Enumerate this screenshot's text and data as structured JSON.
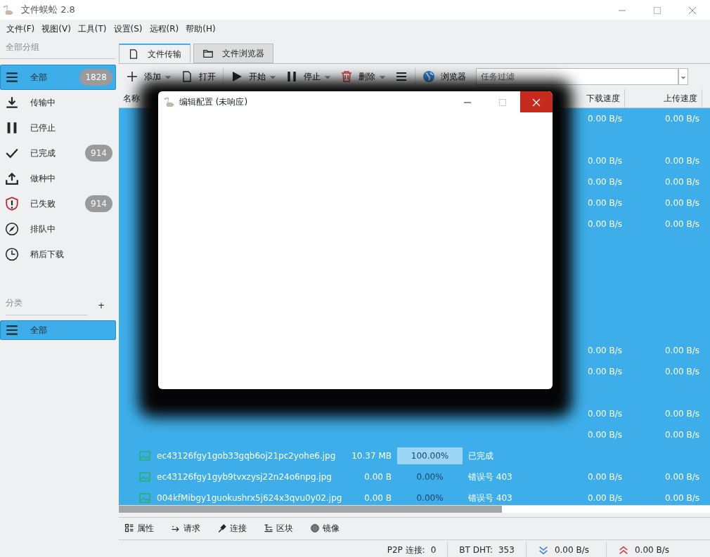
{
  "window": {
    "title": "文件蜈蚣 2.8"
  },
  "menu": [
    "文件(F)",
    "视图(V)",
    "工具(T)",
    "设置(S)",
    "远程(R)",
    "帮助(H)"
  ],
  "sidebar": {
    "groups_label": "全部分组",
    "items": [
      {
        "label": "全部",
        "kind": "menu",
        "count": "1828",
        "selected": true
      },
      {
        "label": "传输中",
        "kind": "download",
        "selected": false
      },
      {
        "label": "已停止",
        "kind": "pause",
        "selected": false
      },
      {
        "label": "已完成",
        "kind": "check",
        "count": "914",
        "selected": false
      },
      {
        "label": "做种中",
        "kind": "upload",
        "selected": false
      },
      {
        "label": "已失败",
        "kind": "shield",
        "count": "914",
        "selected": false
      },
      {
        "label": "排队中",
        "kind": "compass",
        "selected": false
      },
      {
        "label": "稍后下载",
        "kind": "clock",
        "selected": false
      }
    ],
    "categories_label": "分类",
    "add_label": "+",
    "categories": [
      {
        "label": "全部",
        "selected": true
      }
    ]
  },
  "tabs": [
    {
      "label": "文件传输",
      "kind": "file",
      "selected": true
    },
    {
      "label": "文件浏览器",
      "kind": "folder",
      "selected": false
    }
  ],
  "toolbar": [
    {
      "label": "添加",
      "kind": "plus",
      "dropdown": true
    },
    {
      "label": "打开",
      "kind": "file",
      "dropdown": false
    },
    {
      "label": "开始",
      "kind": "play",
      "dropdown": true
    },
    {
      "label": "停止",
      "kind": "pause",
      "dropdown": true
    },
    {
      "label": "删除",
      "kind": "trash",
      "dropdown": true
    },
    {
      "kind": "menu",
      "dropdown": false
    },
    {
      "label": "浏览器",
      "kind": "globe",
      "dropdown": false
    }
  ],
  "filter": {
    "placeholder": "任务过滤"
  },
  "table": {
    "columns": [
      "名称",
      "下载速度",
      "上传速度"
    ],
    "rows": [
      {
        "selected": true,
        "down": "0.00 B/s",
        "up": "0.00 B/s"
      },
      {
        "selected": true
      },
      {
        "selected": true,
        "down": "0.00 B/s",
        "up": "0.00 B/s"
      },
      {
        "selected": true,
        "down": "0.00 B/s",
        "up": "0.00 B/s"
      },
      {
        "selected": true,
        "down": "0.00 B/s",
        "up": "0.00 B/s"
      },
      {
        "selected": true,
        "down": "0.00 B/s",
        "up": "0.00 B/s"
      },
      {
        "selected": true
      },
      {
        "selected": true
      },
      {
        "selected": true
      },
      {
        "selected": true
      },
      {
        "selected": true
      },
      {
        "selected": true,
        "down": "0.00 B/s",
        "up": "0.00 B/s"
      },
      {
        "selected": true,
        "down": "0.00 B/s",
        "up": "0.00 B/s"
      },
      {
        "selected": true
      },
      {
        "selected": true,
        "down": "0.00 B/s",
        "up": "0.00 B/s"
      },
      {
        "selected": true,
        "down": "0.00 B/s",
        "up": "0.00 B/s"
      },
      {
        "selected": true,
        "name": "ec43126fgy1gob33gqb6oj21pc2yohe6.jpg",
        "size": "10.37 MB",
        "progress": "100.00%",
        "status": "已完成"
      },
      {
        "selected": true,
        "name": "ec43126fgy1gyb9tvxzysj22n24o6npg.jpg",
        "size": "0.00 B",
        "progress": "0.00%",
        "status": "错误号 403",
        "down": "0.00 B/s",
        "up": "0.00 B/s"
      },
      {
        "selected": true,
        "name": "004kfMibgy1guokushrx5j624x3qvu0y02.jpg",
        "size": "0.00 B",
        "progress": "0.00%",
        "status": "错误号 403",
        "down": "0.00 B/s",
        "up": "0.00 B/s"
      }
    ]
  },
  "bottom_tabs": [
    {
      "label": "属性",
      "kind": "props"
    },
    {
      "label": "请求",
      "kind": "arrow"
    },
    {
      "label": "连接",
      "kind": "plug"
    },
    {
      "label": "区块",
      "kind": "blocks"
    },
    {
      "label": "镜像",
      "kind": "circle"
    }
  ],
  "status_bar": {
    "p2p_label": "P2P 连接:",
    "p2p": "0",
    "dht_label": "BT DHT:",
    "dht": "353",
    "down": "0.00 B/s",
    "up": "0.00 B/s"
  },
  "dialog": {
    "title": "编辑配置 (未响应)"
  }
}
